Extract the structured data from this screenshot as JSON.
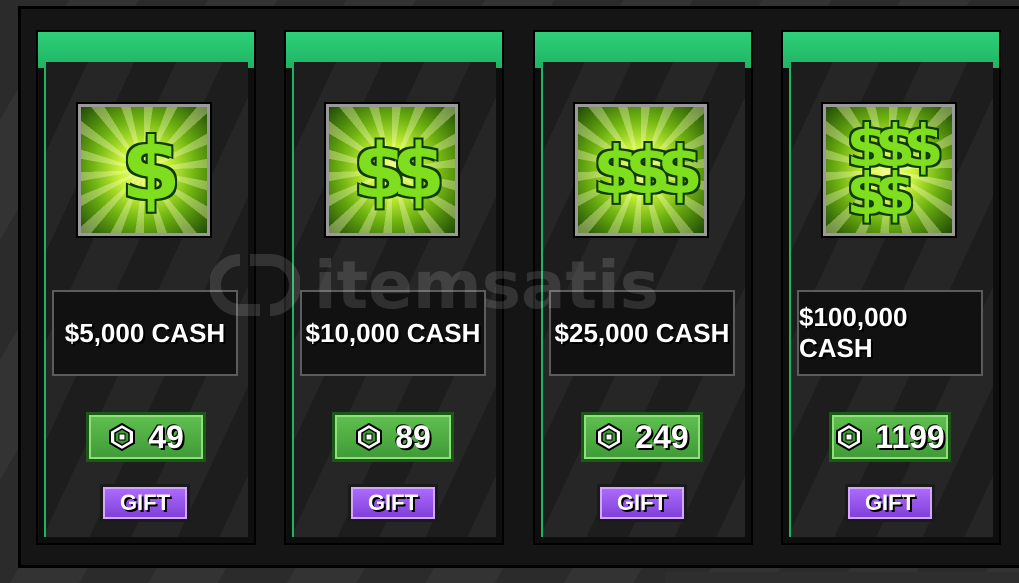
{
  "products": [
    {
      "name": "$5,000 CASH",
      "price": "49",
      "gift_label": "GIFT",
      "icon": "single-dollar-sign-icon",
      "dollar_count": 1
    },
    {
      "name": "$10,000 CASH",
      "price": "89",
      "gift_label": "GIFT",
      "icon": "double-dollar-sign-icon",
      "dollar_count": 2
    },
    {
      "name": "$25,000 CASH",
      "price": "249",
      "gift_label": "GIFT",
      "icon": "triple-dollar-sign-icon",
      "dollar_count": 3
    },
    {
      "name": "$100,000 CASH",
      "price": "1199",
      "gift_label": "GIFT",
      "icon": "dollar-pile-icon",
      "dollar_count": 5
    }
  ],
  "currency_icon": "robux-icon",
  "watermark": "itemsatis",
  "colors": {
    "header_green": "#1fb463",
    "price_green": "#4caf45",
    "gift_purple": "#9a55ec",
    "dollar_green": "#7fdf1e"
  }
}
